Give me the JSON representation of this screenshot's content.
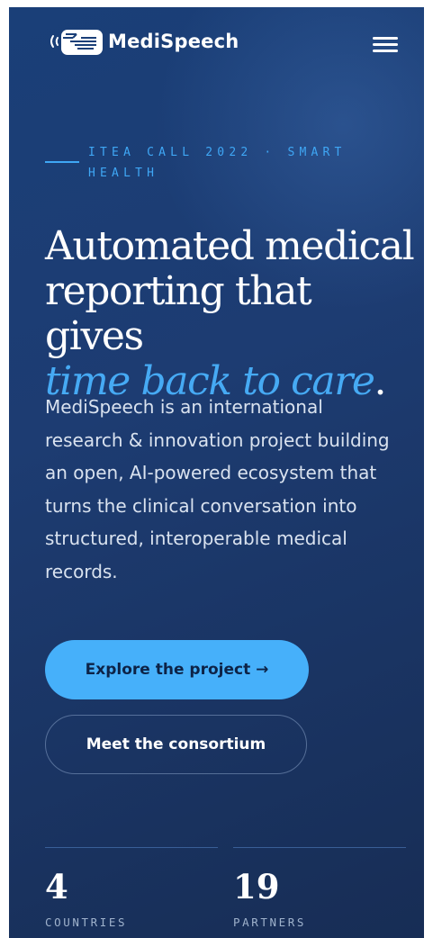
{
  "header": {
    "brand": "MediSpeech",
    "menu_icon": "hamburger-menu-icon",
    "logo_icon": "speech-document-icon"
  },
  "hero": {
    "eyebrow": "ITEA CALL 2022 · SMART HEALTH",
    "headline_line1": "Automated medical",
    "headline_line2": "reporting that gives",
    "headline_accent": "time back to care",
    "headline_end": ".",
    "lede": "MediSpeech is an international research & innovation project building an open, AI-powered ecosystem that turns the clinical conversation into structured, interoperable medical records."
  },
  "actions": {
    "primary_label": "Explore the project →",
    "secondary_label": "Meet the consortium"
  },
  "stats": [
    {
      "value": "4",
      "label": "COUNTRIES"
    },
    {
      "value": "19",
      "label": "PARTNERS"
    }
  ],
  "colors": {
    "background": "#1c3b70",
    "accent": "#46aaf4",
    "primary_button": "#46b0fa"
  }
}
